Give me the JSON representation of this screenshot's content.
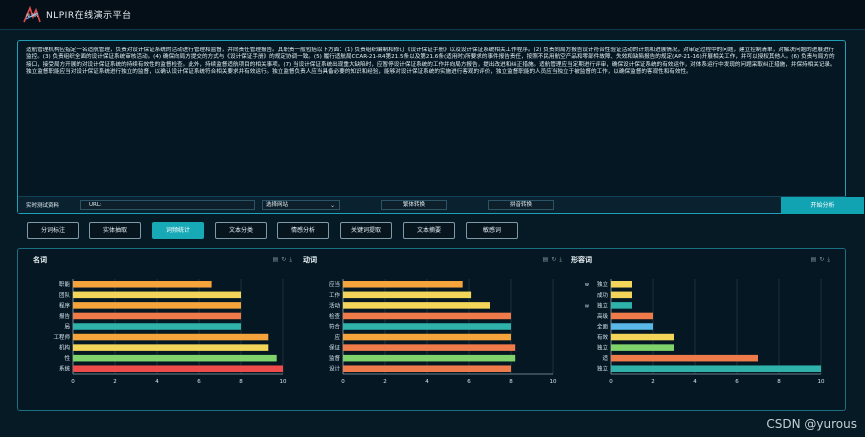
{
  "app": {
    "logo_text": "NLPIR",
    "title": "NLPIR在线演示平台"
  },
  "text_panel": {
    "content": "适航管理机构应指定一名适航管理，负责对设计保证系统的活动进行管理和监督，并向责任管理报告。其职责一般包括以下方面：(1) 负责组织编制和修订《设计保证手册》以及设计保证系统相关工作程序。(2) 负责向局方报告设计符合性验证活动的计划和进展情况，对审定过程中的问题，建立控制清单，对解决问题的进展进行监控。(3) 负责组织全面的设计保证系统审核活动。(4) 确保向局方提交的方式与《设计保证手册》的规定协调一致。(5) 履行适航局CCAR-21-R4第21.5条以及第21.6条(适用时)所要求的事件报告责任，按照不民用航空产品和零部件故障、失效和缺陷报告的规定(AP-21-16)开展相关工作，并可以授权其他人。(6) 负责与局方的接口，接受局方开展的对设计保证系统的持续有效性的监督检查。此外，持续监督适航项目的相关事项。(7) 当设计保证系统出现重大缺陷时，应暂停设计保证系统的工作并向局方报告，提出改进和纠正措施。适航管理应当定期进行评审，确保设计保证系统的有效运作，对体系运行中发现的问题采取纠正措施，并保持相关记录。独立监督职能应当对设计保证系统进行独立的监督，以确认设计保证系统符合相关要求并有效运行。独立监督负责人应当具备必要的知识和经验，能够对设计保证系统的实施进行客观的评价，独立监督职能的人员应当独立于被监督的工作，以确保监督的客观性和有效性。"
  },
  "input_row": {
    "realtime_label": "实时测试资料",
    "url_label": "URL:",
    "select_value": "选择网站",
    "trad_button": "繁体转换",
    "pinyin_button": "拼音转换",
    "analyze_button": "开始分析"
  },
  "tabs": [
    {
      "label": "分词标注"
    },
    {
      "label": "实体抽取"
    },
    {
      "label": "词频统计"
    },
    {
      "label": "文本分类"
    },
    {
      "label": "情感分析"
    },
    {
      "label": "关键词提取"
    },
    {
      "label": "文本摘要"
    },
    {
      "label": "敏感词"
    }
  ],
  "chart_data": [
    {
      "type": "bar",
      "title": "名词",
      "orientation": "horizontal",
      "categories": [
        "职能",
        "团队",
        "程序",
        "报告",
        "局",
        "工程师",
        "机构",
        "性",
        "系统"
      ],
      "values": [
        6.6,
        8,
        8,
        8,
        8,
        9.3,
        9.3,
        9.7,
        10
      ],
      "colors": [
        "#f4a43b",
        "#f3d55a",
        "#f4a43b",
        "#ef7b4b",
        "#2fb2a9",
        "#f4a43b",
        "#f3d55a",
        "#7fd36a",
        "#ef4b4b"
      ],
      "xlim": [
        0,
        10
      ],
      "xticks": [
        0,
        2,
        4,
        6,
        8,
        10
      ]
    },
    {
      "type": "bar",
      "title": "动词",
      "orientation": "horizontal",
      "categories": [
        "应当",
        "工作",
        "活动",
        "检查",
        "符合",
        "应",
        "保证",
        "监督",
        "设计"
      ],
      "values": [
        5.7,
        6.1,
        7,
        8,
        8,
        8,
        8.2,
        8.2,
        8
      ],
      "colors": [
        "#f4a43b",
        "#f3d55a",
        "#f3d55a",
        "#ef7b4b",
        "#2fb2a9",
        "#f4a43b",
        "#ef7b4b",
        "#7fd36a",
        "#ef7b4b"
      ],
      "xlim": [
        0,
        10
      ],
      "xticks": [
        0,
        2,
        4,
        6,
        8,
        10
      ]
    },
    {
      "type": "bar",
      "title": "形容词",
      "orientation": "horizontal",
      "categories": [
        "独立",
        "成功",
        "独立",
        "高级",
        "全面",
        "有效",
        "独立",
        "适",
        "独立"
      ],
      "prefix": [
        "w",
        "",
        "w",
        "",
        "",
        "",
        "",
        "",
        ""
      ],
      "values": [
        1,
        1,
        1,
        2,
        2,
        3,
        3,
        7,
        10
      ],
      "colors": [
        "#f3d55a",
        "#f3d55a",
        "#2fb2a9",
        "#ef7b4b",
        "#5ab8e8",
        "#f3d55a",
        "#7fd36a",
        "#ef7b4b",
        "#2fb2a9"
      ],
      "xlim": [
        0,
        10
      ],
      "xticks": [
        0,
        2,
        4,
        6,
        8,
        10
      ]
    }
  ],
  "footer": {
    "watermark": "CSDN @yurous"
  }
}
